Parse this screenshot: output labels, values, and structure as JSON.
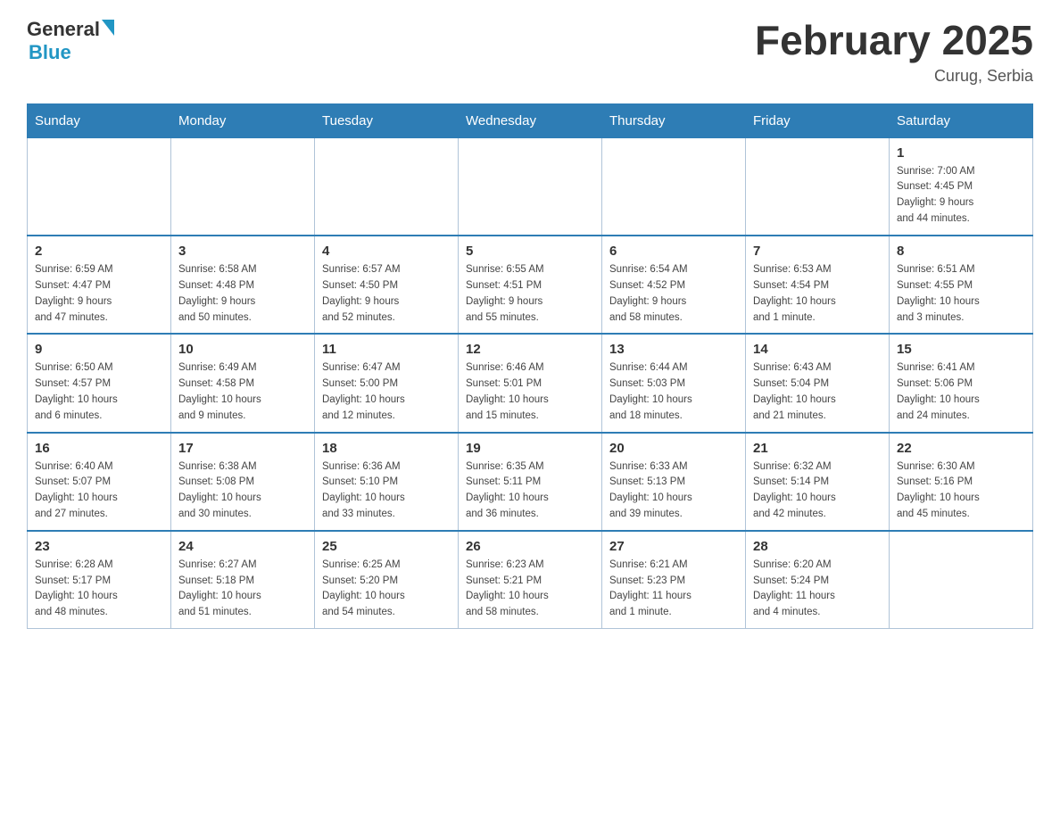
{
  "header": {
    "logo_general": "General",
    "logo_blue": "Blue",
    "month_title": "February 2025",
    "location": "Curug, Serbia"
  },
  "days_of_week": [
    "Sunday",
    "Monday",
    "Tuesday",
    "Wednesday",
    "Thursday",
    "Friday",
    "Saturday"
  ],
  "weeks": [
    [
      {
        "day": "",
        "info": ""
      },
      {
        "day": "",
        "info": ""
      },
      {
        "day": "",
        "info": ""
      },
      {
        "day": "",
        "info": ""
      },
      {
        "day": "",
        "info": ""
      },
      {
        "day": "",
        "info": ""
      },
      {
        "day": "1",
        "info": "Sunrise: 7:00 AM\nSunset: 4:45 PM\nDaylight: 9 hours\nand 44 minutes."
      }
    ],
    [
      {
        "day": "2",
        "info": "Sunrise: 6:59 AM\nSunset: 4:47 PM\nDaylight: 9 hours\nand 47 minutes."
      },
      {
        "day": "3",
        "info": "Sunrise: 6:58 AM\nSunset: 4:48 PM\nDaylight: 9 hours\nand 50 minutes."
      },
      {
        "day": "4",
        "info": "Sunrise: 6:57 AM\nSunset: 4:50 PM\nDaylight: 9 hours\nand 52 minutes."
      },
      {
        "day": "5",
        "info": "Sunrise: 6:55 AM\nSunset: 4:51 PM\nDaylight: 9 hours\nand 55 minutes."
      },
      {
        "day": "6",
        "info": "Sunrise: 6:54 AM\nSunset: 4:52 PM\nDaylight: 9 hours\nand 58 minutes."
      },
      {
        "day": "7",
        "info": "Sunrise: 6:53 AM\nSunset: 4:54 PM\nDaylight: 10 hours\nand 1 minute."
      },
      {
        "day": "8",
        "info": "Sunrise: 6:51 AM\nSunset: 4:55 PM\nDaylight: 10 hours\nand 3 minutes."
      }
    ],
    [
      {
        "day": "9",
        "info": "Sunrise: 6:50 AM\nSunset: 4:57 PM\nDaylight: 10 hours\nand 6 minutes."
      },
      {
        "day": "10",
        "info": "Sunrise: 6:49 AM\nSunset: 4:58 PM\nDaylight: 10 hours\nand 9 minutes."
      },
      {
        "day": "11",
        "info": "Sunrise: 6:47 AM\nSunset: 5:00 PM\nDaylight: 10 hours\nand 12 minutes."
      },
      {
        "day": "12",
        "info": "Sunrise: 6:46 AM\nSunset: 5:01 PM\nDaylight: 10 hours\nand 15 minutes."
      },
      {
        "day": "13",
        "info": "Sunrise: 6:44 AM\nSunset: 5:03 PM\nDaylight: 10 hours\nand 18 minutes."
      },
      {
        "day": "14",
        "info": "Sunrise: 6:43 AM\nSunset: 5:04 PM\nDaylight: 10 hours\nand 21 minutes."
      },
      {
        "day": "15",
        "info": "Sunrise: 6:41 AM\nSunset: 5:06 PM\nDaylight: 10 hours\nand 24 minutes."
      }
    ],
    [
      {
        "day": "16",
        "info": "Sunrise: 6:40 AM\nSunset: 5:07 PM\nDaylight: 10 hours\nand 27 minutes."
      },
      {
        "day": "17",
        "info": "Sunrise: 6:38 AM\nSunset: 5:08 PM\nDaylight: 10 hours\nand 30 minutes."
      },
      {
        "day": "18",
        "info": "Sunrise: 6:36 AM\nSunset: 5:10 PM\nDaylight: 10 hours\nand 33 minutes."
      },
      {
        "day": "19",
        "info": "Sunrise: 6:35 AM\nSunset: 5:11 PM\nDaylight: 10 hours\nand 36 minutes."
      },
      {
        "day": "20",
        "info": "Sunrise: 6:33 AM\nSunset: 5:13 PM\nDaylight: 10 hours\nand 39 minutes."
      },
      {
        "day": "21",
        "info": "Sunrise: 6:32 AM\nSunset: 5:14 PM\nDaylight: 10 hours\nand 42 minutes."
      },
      {
        "day": "22",
        "info": "Sunrise: 6:30 AM\nSunset: 5:16 PM\nDaylight: 10 hours\nand 45 minutes."
      }
    ],
    [
      {
        "day": "23",
        "info": "Sunrise: 6:28 AM\nSunset: 5:17 PM\nDaylight: 10 hours\nand 48 minutes."
      },
      {
        "day": "24",
        "info": "Sunrise: 6:27 AM\nSunset: 5:18 PM\nDaylight: 10 hours\nand 51 minutes."
      },
      {
        "day": "25",
        "info": "Sunrise: 6:25 AM\nSunset: 5:20 PM\nDaylight: 10 hours\nand 54 minutes."
      },
      {
        "day": "26",
        "info": "Sunrise: 6:23 AM\nSunset: 5:21 PM\nDaylight: 10 hours\nand 58 minutes."
      },
      {
        "day": "27",
        "info": "Sunrise: 6:21 AM\nSunset: 5:23 PM\nDaylight: 11 hours\nand 1 minute."
      },
      {
        "day": "28",
        "info": "Sunrise: 6:20 AM\nSunset: 5:24 PM\nDaylight: 11 hours\nand 4 minutes."
      },
      {
        "day": "",
        "info": ""
      }
    ]
  ]
}
